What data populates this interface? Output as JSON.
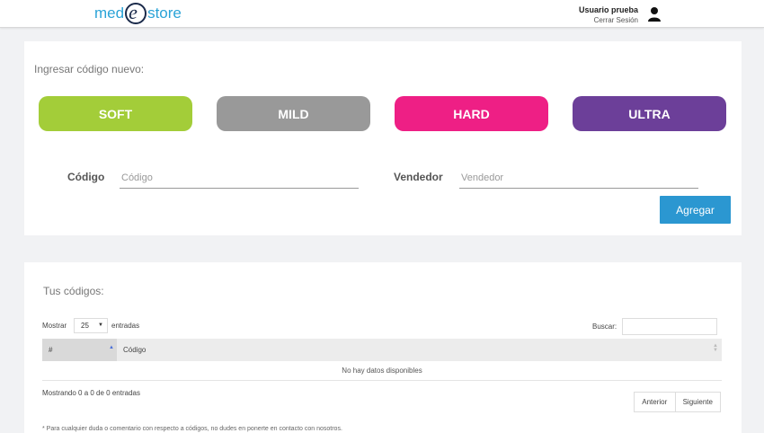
{
  "header": {
    "logo_left": "med",
    "logo_mid": "e",
    "logo_right": "store",
    "user_name": "Usuario prueba",
    "logout": "Cerrar Sesión",
    "user_icon": "user-icon"
  },
  "new_code": {
    "title": "Ingresar código nuevo:",
    "levels": [
      {
        "label": "SOFT",
        "color": "#a3cd39"
      },
      {
        "label": "MILD",
        "color": "#999999"
      },
      {
        "label": "HARD",
        "color": "#ee1f85"
      },
      {
        "label": "ULTRA",
        "color": "#6c3f99"
      }
    ],
    "code_label": "Código",
    "code_placeholder": "Código",
    "seller_label": "Vendedor",
    "seller_placeholder": "Vendedor",
    "add_button": "Agregar"
  },
  "codes": {
    "title": "Tus códigos:",
    "show_label": "Mostrar",
    "page_size": "25",
    "entries_label": "entradas",
    "search_label": "Buscar:",
    "columns": [
      "#",
      "Código"
    ],
    "empty_text": "No hay datos disponibles",
    "info": "Mostrando 0 a 0 de 0 entradas",
    "prev": "Anterior",
    "next": "Siguiente",
    "footnote": "* Para cualquier duda o comentario con respecto a códigos, no dudes en ponerte en contacto con nosotros."
  },
  "colors": {
    "accent": "#2b97d1",
    "logo": "#2aa3d7"
  }
}
